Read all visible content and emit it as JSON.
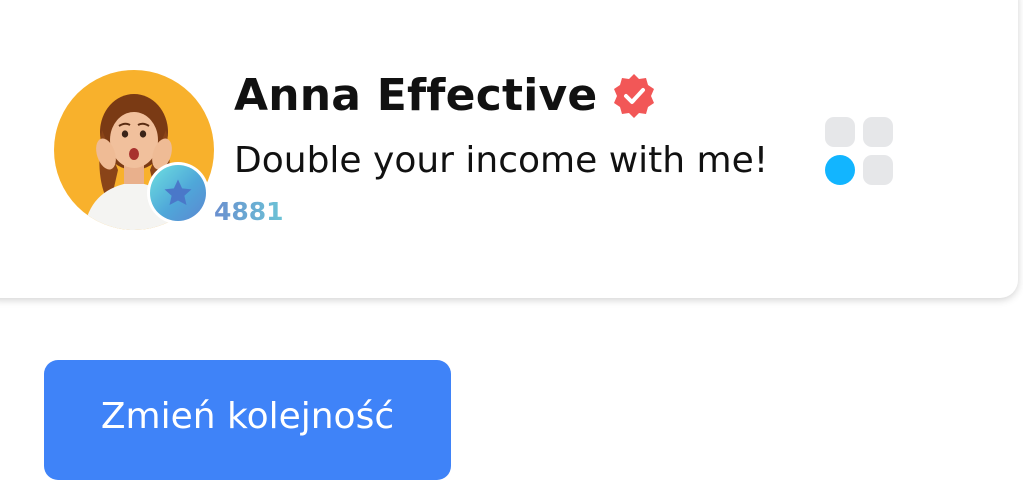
{
  "profile": {
    "name": "Anna Effective",
    "tagline": "Double your income with me!",
    "level": "4881",
    "verified": true,
    "avatar_icon": "person-photo",
    "verified_icon": "verified-badge-icon",
    "level_icon": "star-icon"
  },
  "actions": {
    "reorder_label": "Zmień kolejność"
  },
  "colors": {
    "accent_blue": "#3f83f8",
    "verified_red": "#f25757",
    "avatar_bg": "#f8b12c",
    "grid_active": "#12b5ff",
    "grid_inactive": "#e6e7e9"
  }
}
